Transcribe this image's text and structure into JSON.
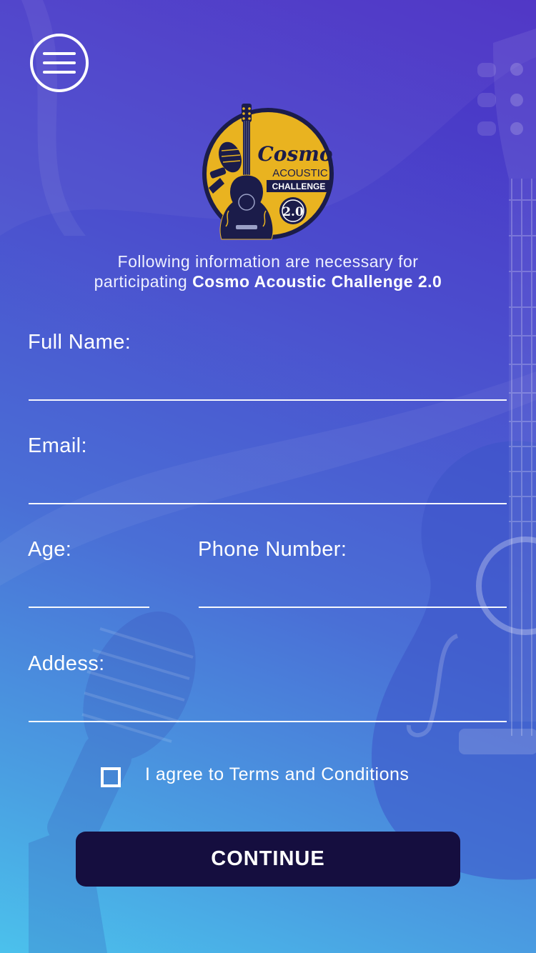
{
  "header": {
    "menu_icon": "hamburger-menu-icon"
  },
  "logo": {
    "word1": "Cosmo",
    "word2": "ACOUSTIC",
    "word3": "CHALLENGE",
    "version": "2.0"
  },
  "intro": {
    "line1": "Following information are necessary for",
    "line2_prefix": "participating ",
    "line2_bold": "Cosmo Acoustic Challenge 2.0"
  },
  "form": {
    "full_name_label": "Full Name:",
    "email_label": "Email:",
    "age_label": "Age:",
    "phone_label": "Phone Number:",
    "address_label": "Addess:",
    "full_name_value": "",
    "email_value": "",
    "age_value": "",
    "phone_value": "",
    "address_value": ""
  },
  "terms": {
    "label": "I agree to Terms and Conditions",
    "checked": false
  },
  "continue_label": "CONTINUE",
  "colors": {
    "button_bg": "#150e3f",
    "logo_yellow": "#e9b320",
    "logo_navy": "#1b1c4a"
  }
}
